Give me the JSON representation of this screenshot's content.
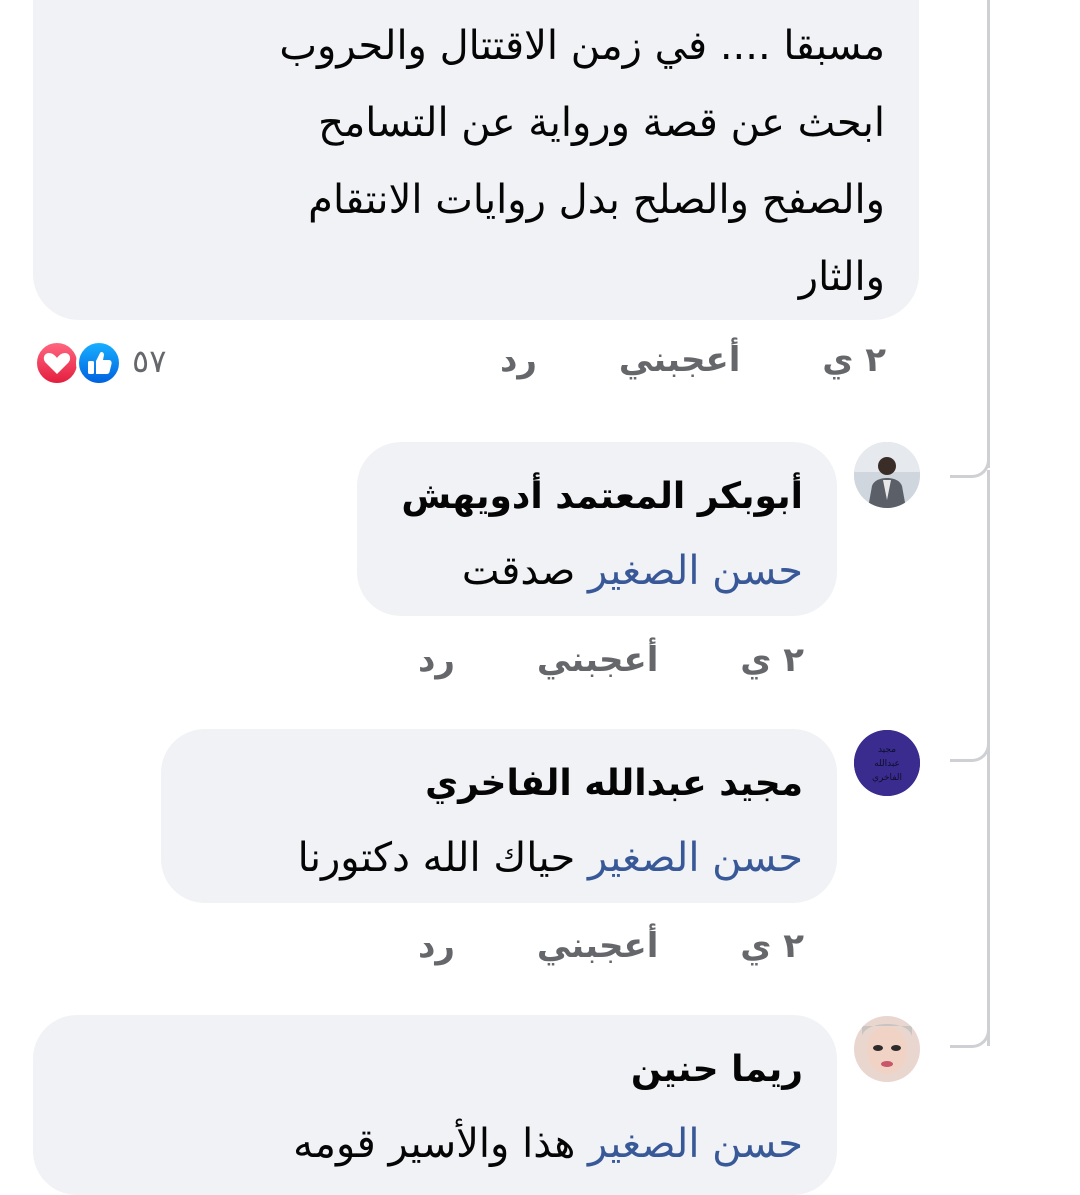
{
  "main_comment": {
    "text": "مسبقا .... في زمن الاقتتال والحروب\nابحث عن قصة ورواية عن التسامح\nوالصفح والصلح  بدل روايات الانتقام\nوالثار",
    "reaction_count": "٥٧",
    "time": "٢ ي",
    "like_label": "أعجبني",
    "reply_label": "رد"
  },
  "replies": [
    {
      "author": "أبوبكر المعتمد أدويهش",
      "mention": "حسن الصغير",
      "text": "صدقت",
      "time": "٢ ي",
      "like_label": "أعجبني",
      "reply_label": "رد"
    },
    {
      "author": "مجيد عبدالله الفاخري",
      "mention": "حسن الصغير",
      "text": "حياك الله دكتورنا",
      "avatar_text": "مجيد عبدالله الفاخري",
      "time": "٢ ي",
      "like_label": "أعجبني",
      "reply_label": "رد"
    },
    {
      "author": "ريما حنين",
      "mention": "حسن الصغير",
      "text": "هذا والأسير قومه"
    }
  ],
  "colors": {
    "bubble": "#f0f2f5",
    "mention": "#385898",
    "meta": "#65676b",
    "like": "#1877f2",
    "love": "#f33e58"
  }
}
